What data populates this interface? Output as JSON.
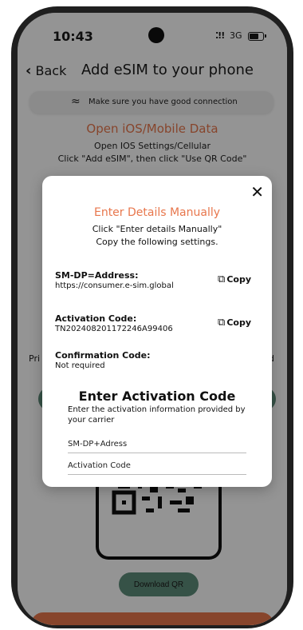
{
  "status_bar": {
    "time": "10:43",
    "network": "3G",
    "signal_glyph": "⁚!!"
  },
  "nav": {
    "back_label": "Back",
    "title": "Add eSIM to your phone"
  },
  "background": {
    "connection_tip": "Make sure you have good connection",
    "heading": "Open iOS/Mobile Data",
    "line1": "Open IOS Settings/Cellular",
    "line2": "Click \"Add eSIM\", then click \"Use QR Code\"",
    "peek_left": "Pri",
    "peek_right": "nd",
    "download_label": "Download QR"
  },
  "modal": {
    "close_glyph": "✕",
    "title": "Enter Details Manually",
    "subtitle1": "Click \"Enter details Manually\"",
    "subtitle2": "Copy the following settings.",
    "fields": [
      {
        "label": "SM-DP=Address:",
        "value": "https://consumer.e-sim.global",
        "copy_label": "Copy"
      },
      {
        "label": "Activation Code:",
        "value": "TN202408201172246A99406",
        "copy_label": "Copy"
      },
      {
        "label": "Confirmation Code:",
        "value": "Not required"
      }
    ],
    "activation": {
      "title": "Enter Activation Code",
      "description": "Enter the activation information provided by your carrier",
      "smdp_placeholder": "SM-DP+Adress",
      "code_placeholder": "Activation Code"
    }
  },
  "colors": {
    "accent": "#e8774d",
    "green": "#5e8d7a",
    "overlay": "rgba(0,0,0,0.42)"
  }
}
